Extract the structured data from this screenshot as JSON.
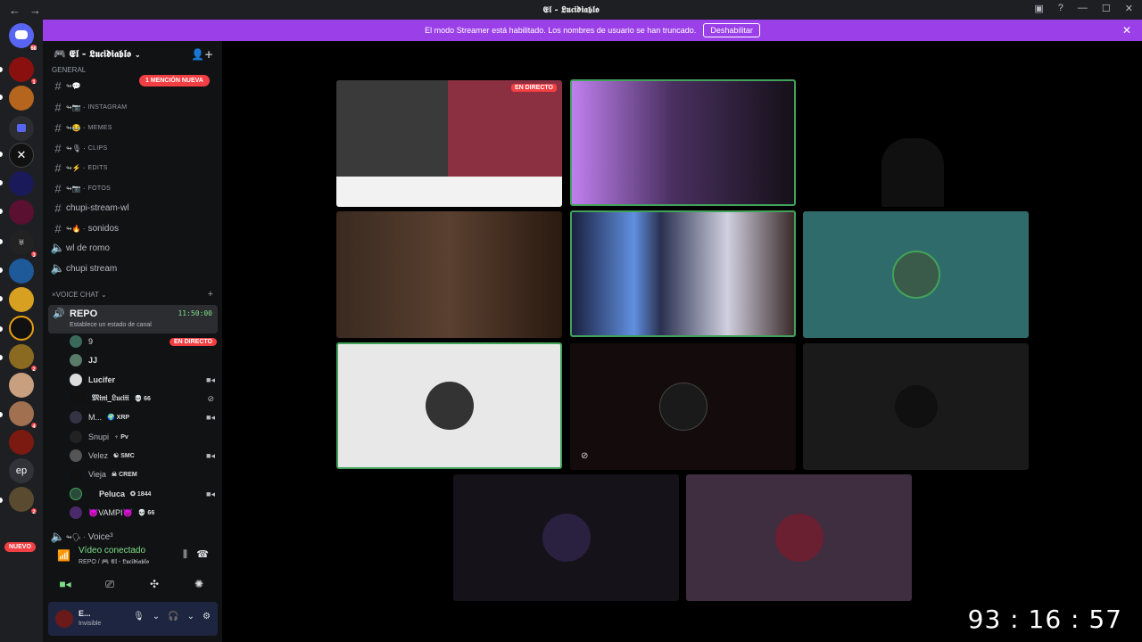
{
  "titlebar": {
    "title": "𝕰𝖑 - 𝕷𝖚𝖈𝖎𝖉𝖎𝖆𝖇𝖑𝖔",
    "back": "←",
    "forward": "→"
  },
  "banner": {
    "message": "El modo Streamer está habilitado. Los nombres de usuario se han truncado.",
    "button": "Deshabilitar"
  },
  "guilds": {
    "home_badge": "68",
    "new_label": "NUEVO",
    "ep_label": "ep",
    "badges": [
      "1",
      "3",
      "2",
      "4",
      "2"
    ]
  },
  "server": {
    "name": "🎮 𝕰𝖑 - 𝕷𝖚𝖈𝖎𝖉𝖎𝖆𝖇𝖑𝖔"
  },
  "channels": {
    "general_category": "GENERAL",
    "mention_badge": "1 MENCIÓN NUEVA",
    "text": [
      {
        "label": "INSTAGRAM",
        "small": true
      },
      {
        "label": "MEMES",
        "small": true
      },
      {
        "label": "CLIPS",
        "small": true
      },
      {
        "label": "EDITS",
        "small": true
      },
      {
        "label": "FOTOS",
        "small": true
      },
      {
        "label": "chupi-stream-wl",
        "small": false
      },
      {
        "label": "sonidos",
        "small": false
      }
    ],
    "voice_plain": [
      "wl de romo",
      "chupi stream"
    ],
    "voice_category": "×VOICE CHAT",
    "last_voice": "Voice³"
  },
  "active_voice": {
    "name": "REPO",
    "time": "11:50:00",
    "status": "Establece un estado de canal"
  },
  "members": [
    {
      "name": "9",
      "tag": "",
      "live": "EN DIRECTO"
    },
    {
      "name": "JJ",
      "tag": ""
    },
    {
      "name": "Lucifer",
      "tag": ""
    },
    {
      "name": "𝔐𝔦𝔫𝔦_𝔏𝔲𝔠𝔦𝔦𝔦",
      "tag": "💀 66"
    },
    {
      "name": "M...",
      "tag": "🌍 XRP"
    },
    {
      "name": "Snupi",
      "tag": "♆ Pv"
    },
    {
      "name": "Velez",
      "tag": "☯ SMC"
    },
    {
      "name": "Vieja",
      "tag": "☠ CREM"
    },
    {
      "name": "Peluca",
      "tag": "✪ 1844"
    },
    {
      "name": "😈VAMPI😈",
      "tag": "💀 66"
    }
  ],
  "rtc": {
    "status": "Vídeo conectado",
    "location": "REPO / 🎮 𝕰𝖑 - 𝕷𝖚𝖈𝖎𝖉𝖎𝖆𝖇𝖑𝖔"
  },
  "user": {
    "name": "E...",
    "status": "Invisible"
  },
  "stage": {
    "live_badge": "EN DIRECTO"
  },
  "timer": "93 : 16 : 57"
}
